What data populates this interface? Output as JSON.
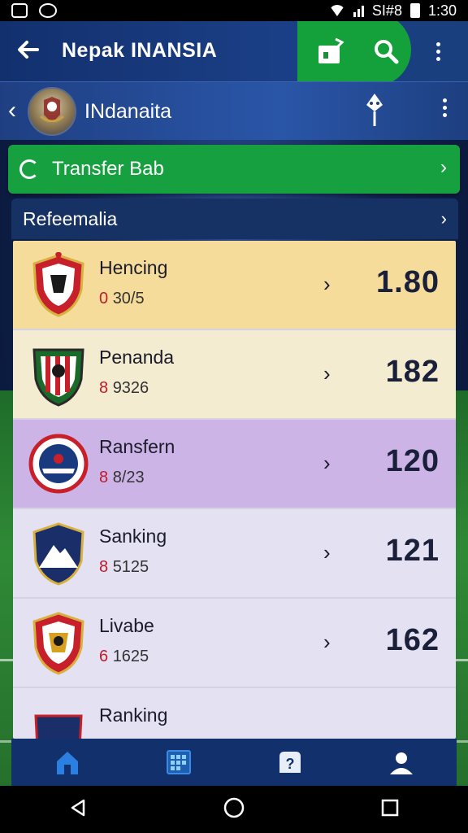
{
  "status_bar": {
    "carrier_text": "SI#8",
    "time": "1:30"
  },
  "app_bar": {
    "title": "Nepak INANSIA",
    "icons": [
      "back-arrow-icon",
      "shop-icon",
      "search-icon",
      "more-vert-icon"
    ]
  },
  "sub_header": {
    "name": "INdanaita",
    "icons": [
      "chevron-left-icon",
      "club-crest-icon",
      "mascot-icon",
      "more-vert-icon"
    ]
  },
  "transfer_banner": {
    "label": "Transfer Bab",
    "color": "#17a040"
  },
  "section": {
    "title": "Refeemalia"
  },
  "rows": [
    {
      "team": "Hencing",
      "meta_prefix": "0",
      "meta": "30/5",
      "score": "1.80",
      "bg": "#f6dc9a",
      "chevron": "›"
    },
    {
      "team": "Penanda",
      "meta_prefix": "8",
      "meta": "9326",
      "score": "182",
      "bg": "#f4ecd0",
      "chevron": "›"
    },
    {
      "team": "Ransfern",
      "meta_prefix": "8",
      "meta": "8/23",
      "score": "120",
      "bg": "#ccb4e6",
      "chevron": "›"
    },
    {
      "team": "Sanking",
      "meta_prefix": "8",
      "meta": "5125",
      "score": "121",
      "bg": "#e4e2f2",
      "chevron": "›"
    },
    {
      "team": "Livabe",
      "meta_prefix": "6",
      "meta": "1625",
      "score": "162",
      "bg": "#e4e2f2",
      "chevron": "›"
    },
    {
      "team": "Ranking",
      "meta_prefix": "",
      "meta": "",
      "score": "",
      "bg": "#e4e2f2",
      "chevron": ""
    }
  ],
  "bottom_nav": {
    "items": [
      "home-icon",
      "calendar-icon",
      "question-icon",
      "profile-icon"
    ]
  },
  "system_nav": {
    "items": [
      "back-icon",
      "home-circle-icon",
      "recents-icon"
    ]
  }
}
